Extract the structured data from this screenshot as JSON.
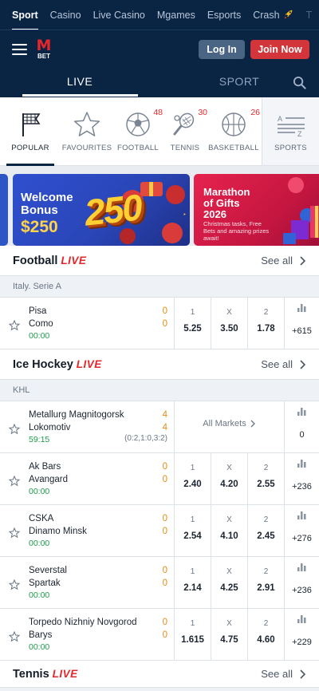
{
  "topnav": {
    "items": [
      "Sport",
      "Casino",
      "Live Casino",
      "Mgames",
      "Esports",
      "Crash",
      "T"
    ]
  },
  "header": {
    "logo_letter": "M",
    "logo_text": "BET",
    "login_label": "Log In",
    "join_label": "Join Now"
  },
  "mode_tabs": {
    "live": "LIVE",
    "sport": "SPORT"
  },
  "categories": {
    "popular": {
      "label": "POPULAR"
    },
    "favourites": {
      "label": "FAVOURITES"
    },
    "football": {
      "label": "FOOTBALL",
      "count": "48"
    },
    "tennis": {
      "label": "TENNIS",
      "count": "30"
    },
    "basketball": {
      "label": "BASKETBALL",
      "count": "26"
    },
    "sports": {
      "label": "SPORTS"
    }
  },
  "banners": {
    "welcome": {
      "line1": "Welcome",
      "line2": "Bonus",
      "amount": "$250",
      "big": "250"
    },
    "marathon": {
      "line1": "Marathon",
      "line2": "of Gifts",
      "line3": "2026",
      "sub": "Christmas tasks, Free Bets and amazing prizes await!"
    }
  },
  "sections": {
    "football": {
      "name": "Football",
      "live": "LIVE",
      "see_all": "See all",
      "league": "Italy. Serie A",
      "matches": [
        {
          "home": "Pisa",
          "away": "Como",
          "time": "00:00",
          "home_score": "0",
          "away_score": "0",
          "k1": "1",
          "kx": "X",
          "k2": "2",
          "o1": "5.25",
          "ox": "3.50",
          "o2": "1.78",
          "more": "+615"
        }
      ]
    },
    "hockey": {
      "name": "Ice Hockey",
      "live": "LIVE",
      "see_all": "See all",
      "league": "KHL",
      "all_markets": "All Markets",
      "matches": [
        {
          "home": "Metallurg Magnitogorsk",
          "away": "Lokomotiv",
          "time": "59:15",
          "home_score": "4",
          "away_score": "4",
          "periods": "(0:2,1:0,3:2)",
          "more": "0"
        },
        {
          "home": "Ak Bars",
          "away": "Avangard",
          "time": "00:00",
          "home_score": "0",
          "away_score": "0",
          "k1": "1",
          "kx": "X",
          "k2": "2",
          "o1": "2.40",
          "ox": "4.20",
          "o2": "2.55",
          "more": "+236"
        },
        {
          "home": "CSKA",
          "away": "Dinamo Minsk",
          "time": "00:00",
          "home_score": "0",
          "away_score": "0",
          "k1": "1",
          "kx": "X",
          "k2": "2",
          "o1": "2.54",
          "ox": "4.10",
          "o2": "2.45",
          "more": "+276"
        },
        {
          "home": "Severstal",
          "away": "Spartak",
          "time": "00:00",
          "home_score": "0",
          "away_score": "0",
          "k1": "1",
          "kx": "X",
          "k2": "2",
          "o1": "2.14",
          "ox": "4.25",
          "o2": "2.91",
          "more": "+236"
        },
        {
          "home": "Torpedo Nizhniy Novgorod",
          "away": "Barys",
          "time": "00:00",
          "home_score": "0",
          "away_score": "0",
          "k1": "1",
          "kx": "X",
          "k2": "2",
          "o1": "1.615",
          "ox": "4.75",
          "o2": "4.60",
          "more": "+229"
        }
      ]
    },
    "tennis": {
      "name": "Tennis",
      "live": "LIVE",
      "see_all": "See all"
    }
  },
  "colors": {
    "navy": "#0a2444",
    "brand_red": "#e5262a",
    "score_orange": "#e38b1a",
    "time_green": "#1e9c4b"
  }
}
